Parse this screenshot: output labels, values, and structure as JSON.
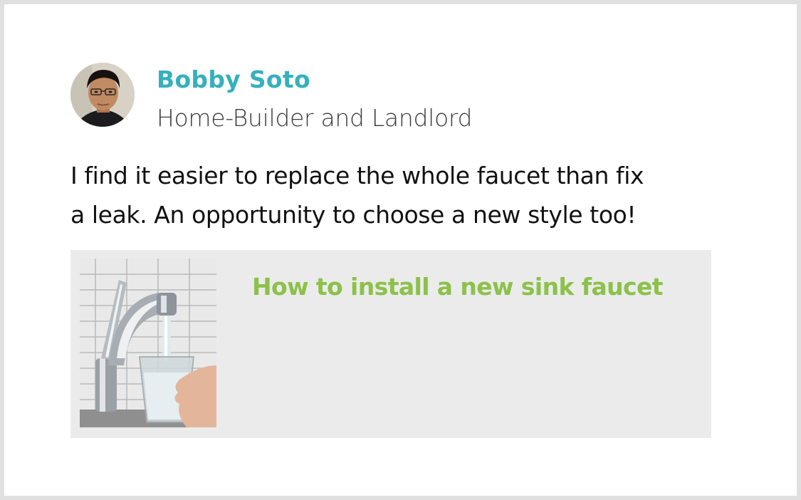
{
  "post": {
    "author": {
      "name": "Bobby Soto",
      "title": "Home-Builder and Landlord"
    },
    "text_lines": [
      "I find it easier to replace the whole faucet than fix",
      "a leak. An opportunity to choose a new style too!"
    ],
    "link": {
      "title": "How to install a new sink faucet"
    }
  },
  "colors": {
    "author_name": "#36b0bd",
    "link_title": "#8cc14a",
    "link_card_bg": "#ebebeb",
    "body_text": "#111111",
    "subtitle_text": "#3a3a3a",
    "frame_border": "#e0e0e0"
  },
  "icons": {
    "avatar": "person-portrait-photo",
    "thumbnail": "faucet-pouring-water-photo"
  }
}
